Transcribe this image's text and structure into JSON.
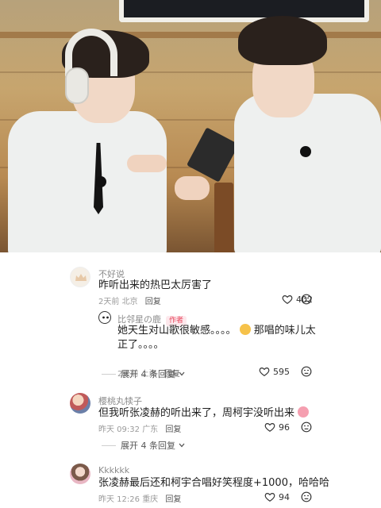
{
  "comments": [
    {
      "username": "不好说",
      "text": "昨听出来的热巴太厉害了",
      "time": "2天前",
      "location": "北京",
      "reply_label": "回复",
      "likes": "402"
    },
    {
      "username": "比邻星の鹿",
      "badge": "作者",
      "text_part1": "她天生对山歌很敏感。。。。",
      "text_part2": "那唱的味儿太正了。。。。",
      "time": "2天前",
      "location": "上海",
      "reply_label": "回复",
      "likes": "595",
      "expand_label": "展开 4 条回复"
    },
    {
      "username": "樱桃丸犊子",
      "text": "但我听张凌赫的听出来了，周柯宇没听出来",
      "time": "昨天 09:32",
      "location": "广东",
      "reply_label": "回复",
      "likes": "96",
      "expand_label": "展开 4 条回复"
    },
    {
      "username": "Kkkkkk",
      "text": "张凌赫最后还和柯宇合唱好笑程度+1000，哈哈哈",
      "time": "昨天 12:26",
      "location": "重庆",
      "reply_label": "回复",
      "likes": "94"
    }
  ],
  "colors": {
    "author_badge": "#e8455c",
    "meta_text": "#9a9a9a",
    "background": "#ffffff"
  },
  "icons": {
    "like": "heart-outline-icon",
    "dislike": "dislike-face-icon"
  }
}
